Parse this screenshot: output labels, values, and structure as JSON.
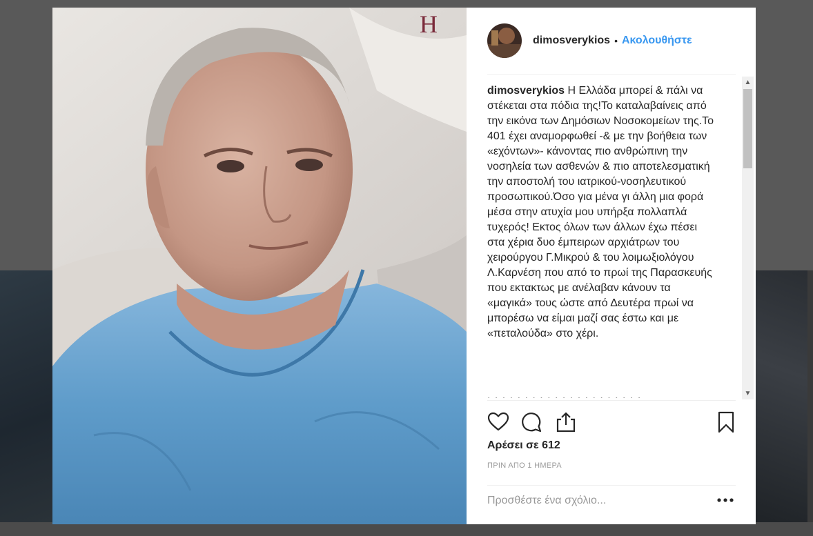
{
  "post": {
    "username": "dimosverykios",
    "separator": "•",
    "follow_label": "Ακολουθήστε",
    "caption": "Η Ελλάδα μπορεί & πάλι να στέκεται στα πόδια της!Το καταλαβαίνεις από την εικόνα των Δημόσιων Νοσοκομείων της.Το 401 έχει αναμορφωθεί -& με την βοήθεια των «εχόντων»- κάνοντας πιο ανθρώπινη την νοσηλεία των ασθενών & πιο αποτελεσματική την αποστολή του ιατρικού-νοσηλευτικού προσωπικού.Όσο για μένα γι άλλη μια φορά μέσα στην ατυχία μου υπήρξα πολλαπλά τυχερός! Εκτος όλων των άλλων έχω πέσει στα χέρια δυο έμπειρων αρχιάτρων του χειρούργου Γ.Μικρού & του λοιμωξιολόγου Λ.Καρνέση που από το πρωί της Παρασκευής που εκτακτως με ανέλαβαν κάνουν τα «μαγικά» τους ώστε από Δευτέρα πρωί να μπορέσω να είμαι μαζί σας έστω και με «πεταλούδα» στο χέρι.",
    "likes_text": "Αρέσει σε 612",
    "timestamp": "ΠΡΙΝ ΑΠΟ 1 ΗΜΕΡΑ",
    "comment_placeholder": "Προσθέστε ένα σχόλιο..."
  },
  "icons": {
    "like": "heart-icon",
    "comment": "comment-icon",
    "share": "share-icon",
    "save": "bookmark-icon",
    "more": "more-options-icon"
  },
  "colors": {
    "follow_blue": "#3897f0",
    "text": "#262626",
    "muted": "#999999",
    "overlay": "#595959"
  }
}
